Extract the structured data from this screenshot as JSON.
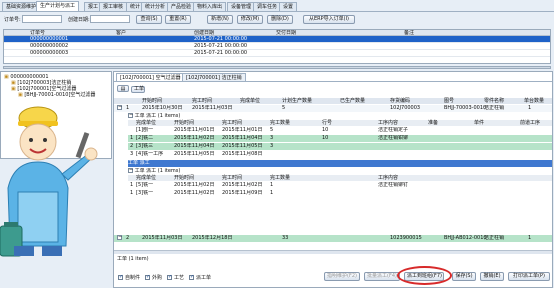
{
  "tabs": [
    "基础资源维护",
    "生产计划与派工",
    "报工",
    "报工审核",
    "统计",
    "统计分析",
    "产品检验",
    "物料入库出",
    "设备管理",
    "调车任务",
    "设置"
  ],
  "filters": {
    "order_label": "订单号:",
    "date_label": "创建日期:",
    "date_value": "",
    "query": "查询(S)",
    "reset": "重置(R)",
    "add": "新增(N)",
    "edit": "修改(M)",
    "delete": "删除(D)",
    "import": "从ERP导入订单(I)"
  },
  "top_grid": {
    "headers": [
      "订单号",
      "客户",
      "创建日期",
      "交付日期",
      "备注"
    ],
    "rows": [
      [
        "000000000001",
        "",
        "2015-07-21 00:00:00",
        "",
        ""
      ],
      [
        "000000000002",
        "",
        "2015-07-21 00:00:00",
        "",
        ""
      ],
      [
        "000000000003",
        "",
        "2015-07-21 00:00:00",
        "",
        ""
      ]
    ]
  },
  "tree": {
    "root": "000000000001",
    "nodes": [
      "[102J700003]洁正柱销",
      "[102J700001]空气过滤器",
      "[BHJJ-70001-0010]空气过滤器"
    ]
  },
  "panel_tabs": [
    "[102J700001] 空气过滤器",
    "[102J700001] 洁正柱销"
  ],
  "toolbar": {
    "label": "工单"
  },
  "detail": {
    "col_headers": [
      "开始时间",
      "完工时间",
      "完成单位",
      "计划生产数量",
      "已生产数量",
      "存货编码",
      "图号",
      "零件名称",
      "单台数量"
    ],
    "work_order_1": {
      "index": "1",
      "start": "2015年10月30日",
      "end": "2015年11月03日",
      "unit": "",
      "plan": "5",
      "done": "",
      "code": "102J700003",
      "drawing": "BHJJ-70003-0010",
      "name": "洁正柱销",
      "qty": "1"
    },
    "child_label": "工单 派工 (1 items)",
    "sub_headers": [
      "完成单位",
      "开始时间",
      "完工时间",
      "完工数量",
      "行号",
      "工序内容",
      "准备",
      "单件",
      "前道工序"
    ],
    "sub_1": {
      "unit": "[1]刨一",
      "start": "2015年11月01日",
      "end": "2015年11月01日",
      "qty": "5",
      "line": "10",
      "content": "洁正柱销定子",
      "prep": "",
      "each": "",
      "prev": ""
    },
    "sub_2": {
      "idx": "1",
      "unit": "[2]铣二",
      "start": "2015年11月02日",
      "end": "2015年11月04日",
      "qty": "3",
      "line": "10",
      "content": "洁正柱销钳铆",
      "prep": "",
      "each": "",
      "prev": ""
    },
    "sub_3": {
      "idx": "2",
      "unit": "[3]铣三",
      "start": "2015年11月04日",
      "end": "2015年11月05日",
      "qty": "3",
      "line": "",
      "content": "",
      "prep": "",
      "each": "",
      "prev": ""
    },
    "sub_4": {
      "idx": "3",
      "unit": "[4]铣一工序",
      "start": "2015年11月05日",
      "end": "2015年11月08日",
      "qty": "",
      "line": "",
      "content": "",
      "prep": "",
      "each": "",
      "prev": ""
    },
    "group_2": "工单 派工",
    "row2_label": "工单 派工 (1 items)",
    "sub_5": {
      "idx": "1",
      "unit": "[5]铣一",
      "start": "2015年11月02日",
      "end": "2015年11月02日",
      "qty": "1",
      "line": "",
      "content": "洁正柱销铆钉",
      "prep": "",
      "each": "",
      "prev": ""
    },
    "sub_6": {
      "idx": "1",
      "unit": "[3]铣一",
      "start": "2015年11月02日",
      "end": "2015年11月09日",
      "qty": "1",
      "line": "",
      "content": "",
      "prep": "",
      "each": "",
      "prev": ""
    },
    "work_order_2": {
      "index": "2",
      "start": "2015年11月03日",
      "end": "2015年12月18日",
      "unit": "",
      "plan": "33",
      "done": "",
      "code": "1023900015",
      "drawing": "BHJJ-AB012-0010",
      "name": "洁正柱销",
      "qty": "1"
    }
  },
  "footer": {
    "items": "工单 (1 item)",
    "cb1": "自制件",
    "cb2": "外购",
    "cb3": "工艺",
    "cb4": "派工单",
    "b1": "指明维护(F2)",
    "b2": "批量派工(F4)",
    "b3": "派工到班组(F7)",
    "b4": "保存(S)",
    "b5": "撤销(E)",
    "b6": "打印派工单(P)"
  },
  "colors": {
    "accent": "#1f62c8",
    "highlight": "#b6e3c9",
    "marker": "#d72a2a"
  }
}
